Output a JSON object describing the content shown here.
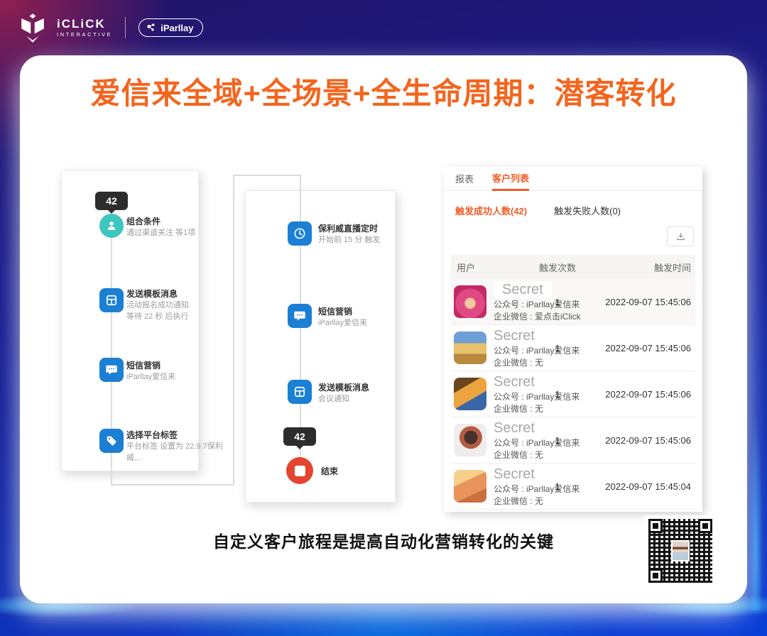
{
  "brand": {
    "iclick": "iCLiCK",
    "iclick_sub": "INTERACTIVE",
    "iparllay": "iParllay"
  },
  "title": "爱信来全域+全场景+全生命周期：潜客转化",
  "caption": "自定义客户旅程是提高自动化营销转化的关键",
  "flow_left": {
    "badge": "42",
    "steps": [
      {
        "title": "组合条件",
        "sub1": "通过渠道关注 等1项",
        "sub2": ""
      },
      {
        "title": "发送模板消息",
        "sub1": "活动报名成功通知",
        "sub2": "等待 22 秒 后执行"
      },
      {
        "title": "短信营销",
        "sub1": "iParllay爱信来",
        "sub2": ""
      },
      {
        "title": "选择平台标签",
        "sub1": "平台标签 设置为 22.9.7保利威...",
        "sub2": ""
      }
    ]
  },
  "flow_right": {
    "badge": "42",
    "steps": [
      {
        "title": "保利威直播定时",
        "sub1": "开始前 15 分 触发"
      },
      {
        "title": "短信营销",
        "sub1": "iParllay爱信来"
      },
      {
        "title": "发送模板消息",
        "sub1": "会议通知"
      },
      {
        "title": "结束",
        "sub1": ""
      }
    ]
  },
  "panel": {
    "tabs": [
      {
        "label": "报表"
      },
      {
        "label": "客户列表"
      }
    ],
    "stats": [
      {
        "label": "触发成功人数(42)"
      },
      {
        "label": "触发失败人数(0)"
      }
    ],
    "table": {
      "headers": [
        "用户",
        "触发次数",
        "触发时间"
      ],
      "rows": [
        {
          "name": "Secret",
          "account": "公众号 : iParllay爱信来",
          "wecom": "企业微信 : 爱点击iClick",
          "count": "1",
          "time": "2022-09-07 15:45:06"
        },
        {
          "name": "Secret",
          "account": "公众号 : iParllay爱信来",
          "wecom": "企业微信 : 无",
          "count": "1",
          "time": "2022-09-07 15:45:06"
        },
        {
          "name": "Secret",
          "account": "公众号 : iParllay爱信来",
          "wecom": "企业微信 : 无",
          "count": "1",
          "time": "2022-09-07 15:45:06"
        },
        {
          "name": "Secret",
          "account": "公众号 : iParllay爱信来",
          "wecom": "企业微信 : 无",
          "count": "1",
          "time": "2022-09-07 15:45:06"
        },
        {
          "name": "Secret",
          "account": "公众号 : iParllay爱信来",
          "wecom": "企业微信 : 无",
          "count": "1",
          "time": "2022-09-07 15:45:04"
        }
      ]
    }
  },
  "colors": {
    "title_orange": "#f2661f",
    "tab_active_orange": "#f25b24",
    "icon_blue": "#1b7fd4",
    "icon_teal": "#3fc6c1",
    "end_red": "#e5452f",
    "badge_black": "#2d2d2d"
  }
}
